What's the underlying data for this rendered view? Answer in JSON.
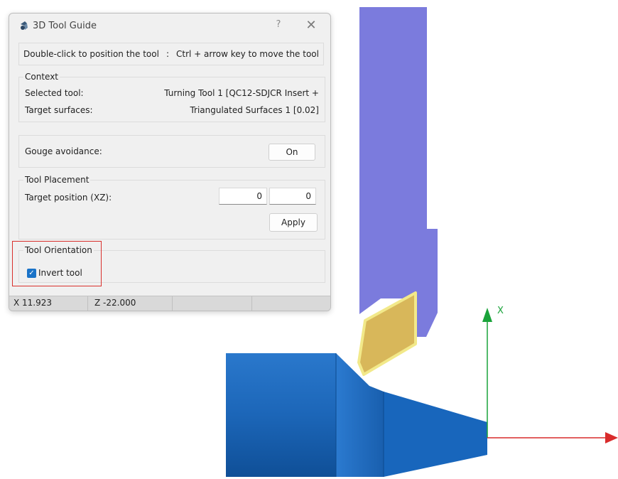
{
  "dialog": {
    "title": "3D Tool Guide",
    "help_label": "?",
    "close_label": "✕",
    "hint": {
      "left": "Double-click to position the tool",
      "separator": ":",
      "right": "Ctrl + arrow key to move the tool"
    },
    "context": {
      "title": "Context",
      "selected_tool_label": "Selected tool:",
      "selected_tool_value": "Turning Tool 1 [QC12-SDJCR Insert +",
      "target_surfaces_label": "Target surfaces:",
      "target_surfaces_value": "Triangulated Surfaces 1 [0.02]"
    },
    "gouge": {
      "label": "Gouge avoidance:",
      "button": "On"
    },
    "placement": {
      "title": "Tool Placement",
      "target_label": "Target position (XZ):",
      "x_value": "0",
      "z_value": "0",
      "apply": "Apply"
    },
    "orientation": {
      "title": "Tool Orientation",
      "invert_label": "Invert tool",
      "invert_checked": true
    },
    "status": {
      "x": "X  11.923",
      "z": "Z  -22.000"
    }
  },
  "viewport": {
    "x_axis_label": "X",
    "colors": {
      "tool_holder": "#7b7bdd",
      "insert": "#d8b75a",
      "workpiece": "#1763b8",
      "x_axis": "#1aa33a",
      "z_axis": "#d92b2b"
    }
  }
}
